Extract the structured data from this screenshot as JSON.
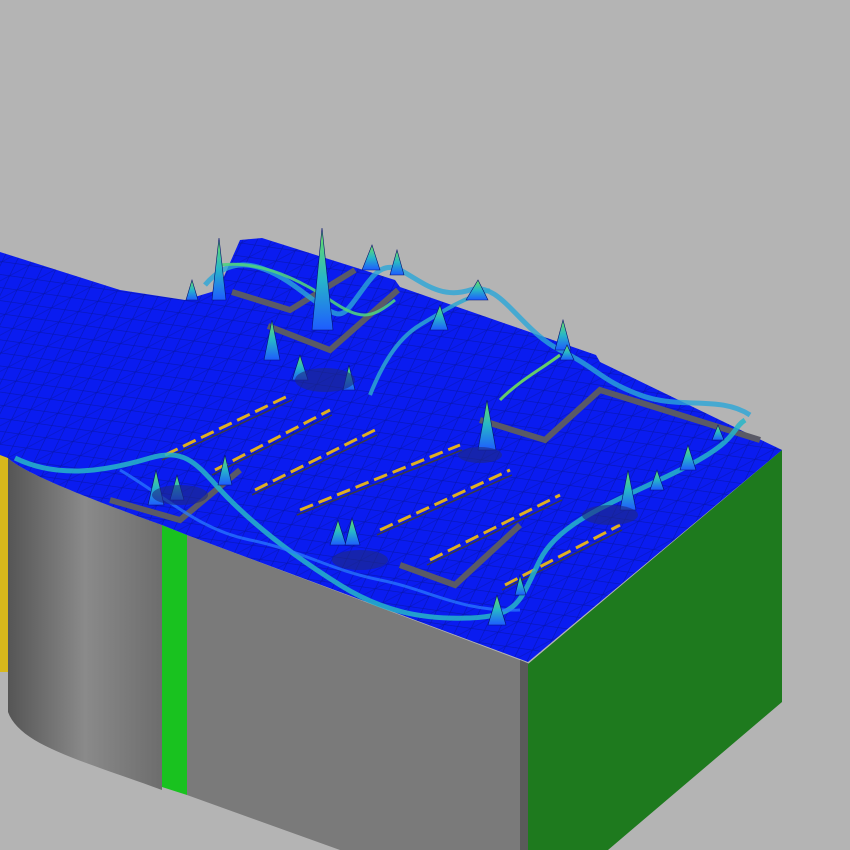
{
  "viewport": {
    "background": "#b4b4b4"
  },
  "model": {
    "colors": {
      "mesh_surface": "#0a1cf0",
      "mesh_lines": "#041070",
      "field_low": "#1e5cff",
      "field_mid": "#27b6c8",
      "field_high": "#6fe05a",
      "inset_border": "#5a5a66",
      "yellow_traces": "#e0b020",
      "side_wall_grey": "#7a7a7a",
      "side_wall_dark": "#4e4e4e",
      "front_face_green": "#1e7a1e",
      "stripe_green": "#19c21f",
      "end_face_yellow": "#d8b81c"
    },
    "icons": [
      "mesh-surface",
      "field-peaks"
    ]
  }
}
